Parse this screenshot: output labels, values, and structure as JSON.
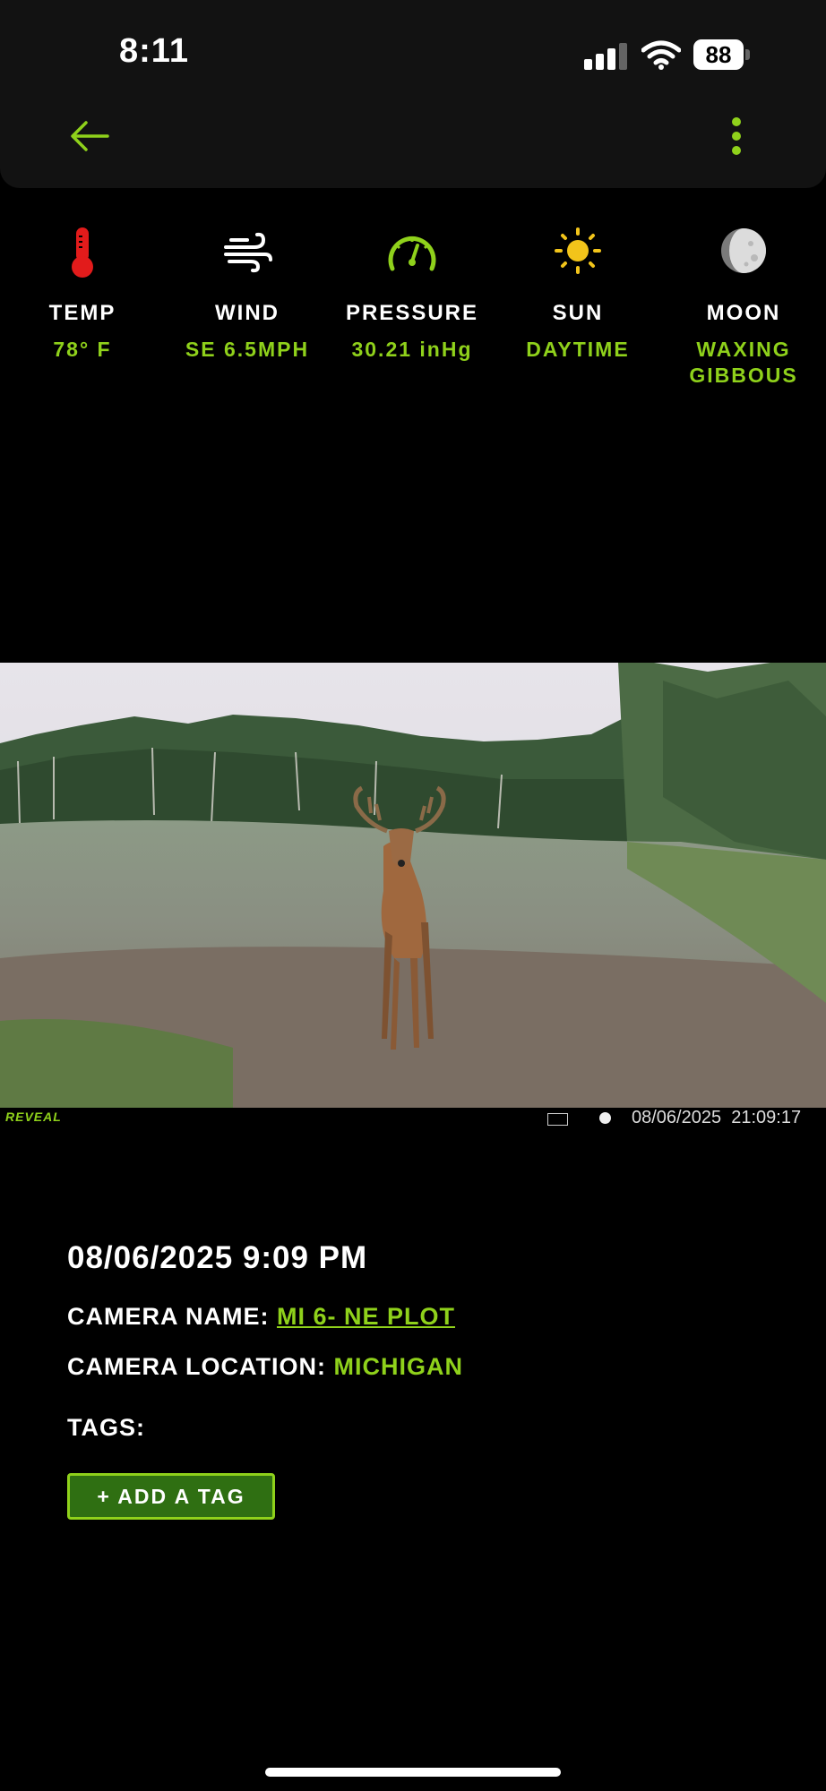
{
  "status_bar": {
    "time": "8:11",
    "battery": "88"
  },
  "weather": [
    {
      "label": "TEMP",
      "value": "78° F",
      "icon": "thermometer-icon"
    },
    {
      "label": "WIND",
      "value": "SE 6.5MPH",
      "icon": "wind-icon"
    },
    {
      "label": "PRESSURE",
      "value": "30.21 inHg",
      "icon": "gauge-icon"
    },
    {
      "label": "SUN",
      "value": "DAYTIME",
      "icon": "sun-icon"
    },
    {
      "label": "MOON",
      "value_lines": [
        "WAXING",
        "GIBBOUS"
      ],
      "icon": "moon-icon"
    }
  ],
  "photo": {
    "brand": "REVEAL",
    "stamp_date": "08/06/2025",
    "stamp_time": "21:09:17"
  },
  "details": {
    "date": "08/06/2025 9:09 PM",
    "camera_name_label": "CAMERA NAME:",
    "camera_name": "MI 6- NE PLOT",
    "camera_location_label": "CAMERA LOCATION:",
    "camera_location": "MICHIGAN",
    "tags_label": "TAGS:",
    "add_tag_label": "+ ADD A TAG"
  },
  "colors": {
    "accent": "#8fd11b",
    "button_fill": "#2f6f12",
    "temp_red": "#e21b1b",
    "sun_yellow": "#f2c41a"
  }
}
